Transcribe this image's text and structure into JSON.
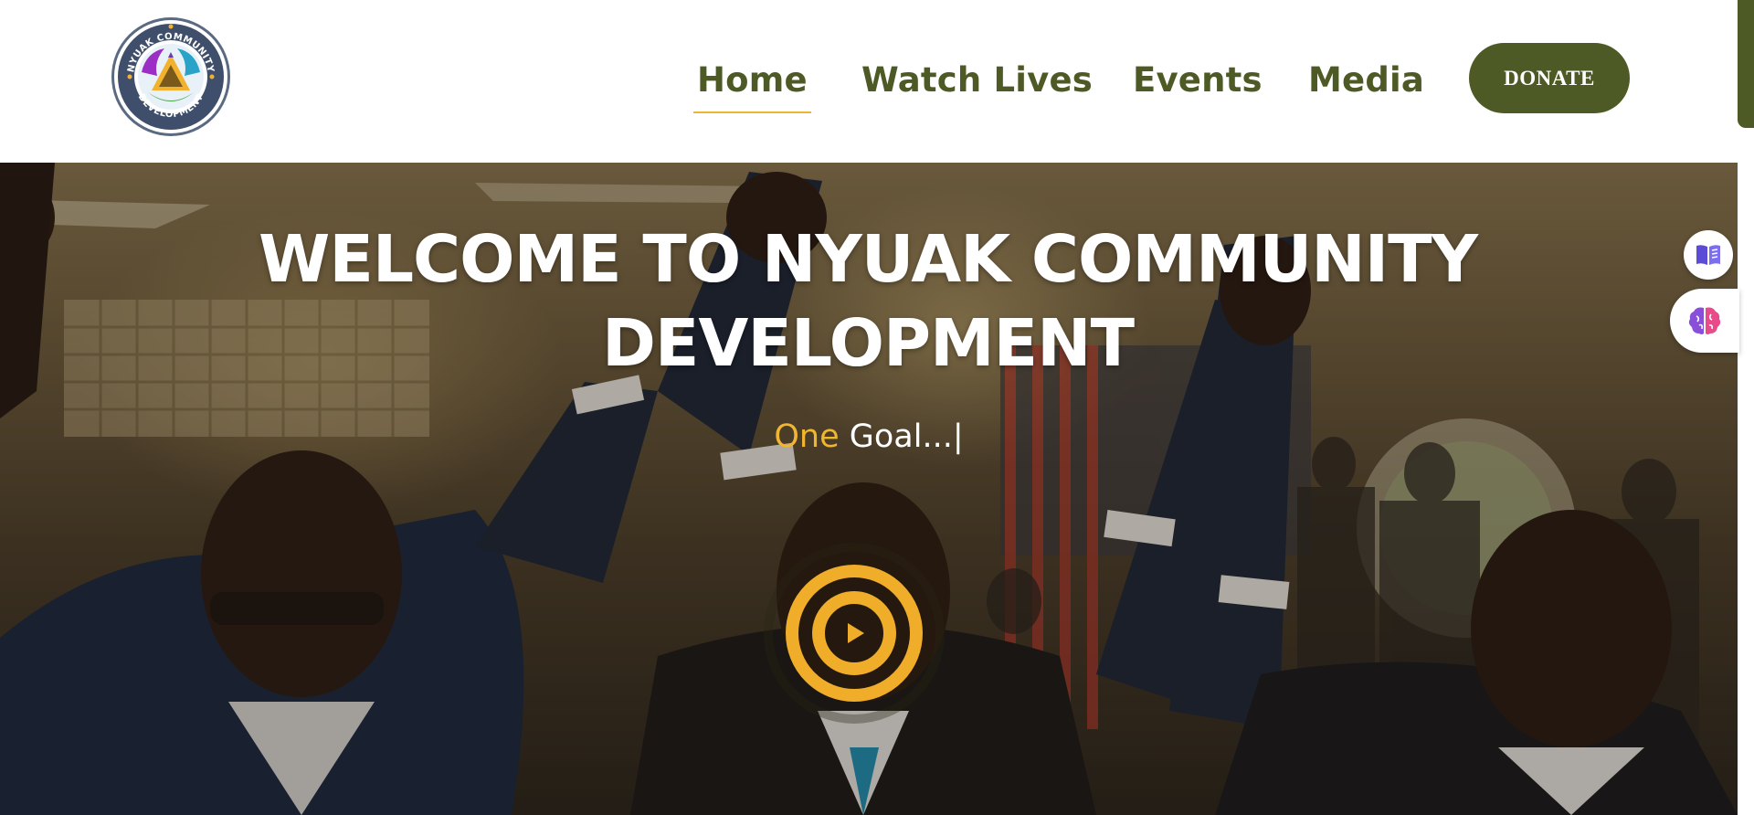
{
  "logo": {
    "alt": "NYUAK COMMUNITY DEVELOPMENT",
    "text_top": "NYUAK COMMUNITY",
    "text_bottom": "DEVELOPMENT"
  },
  "nav": {
    "items": [
      {
        "label": "Home",
        "active": true
      },
      {
        "label": "Watch Lives",
        "active": false
      },
      {
        "label": "Events",
        "active": false
      },
      {
        "label": "Media",
        "active": false
      }
    ],
    "donate_label": "DONATE"
  },
  "hero": {
    "title_line1": "WELCOME TO NYUAK COMMUNITY",
    "title_line2": "DEVELOPMENT",
    "subtitle_accent": "One",
    "subtitle_rest": " Goal...|",
    "play_icon": "play-icon"
  },
  "side_widgets": {
    "book_icon": "book-icon",
    "brain_icon": "brain-icon"
  },
  "colors": {
    "brand_green": "#4d5a25",
    "accent_gold": "#f0b531",
    "nav_underline": "#e8b733",
    "white": "#ffffff"
  }
}
